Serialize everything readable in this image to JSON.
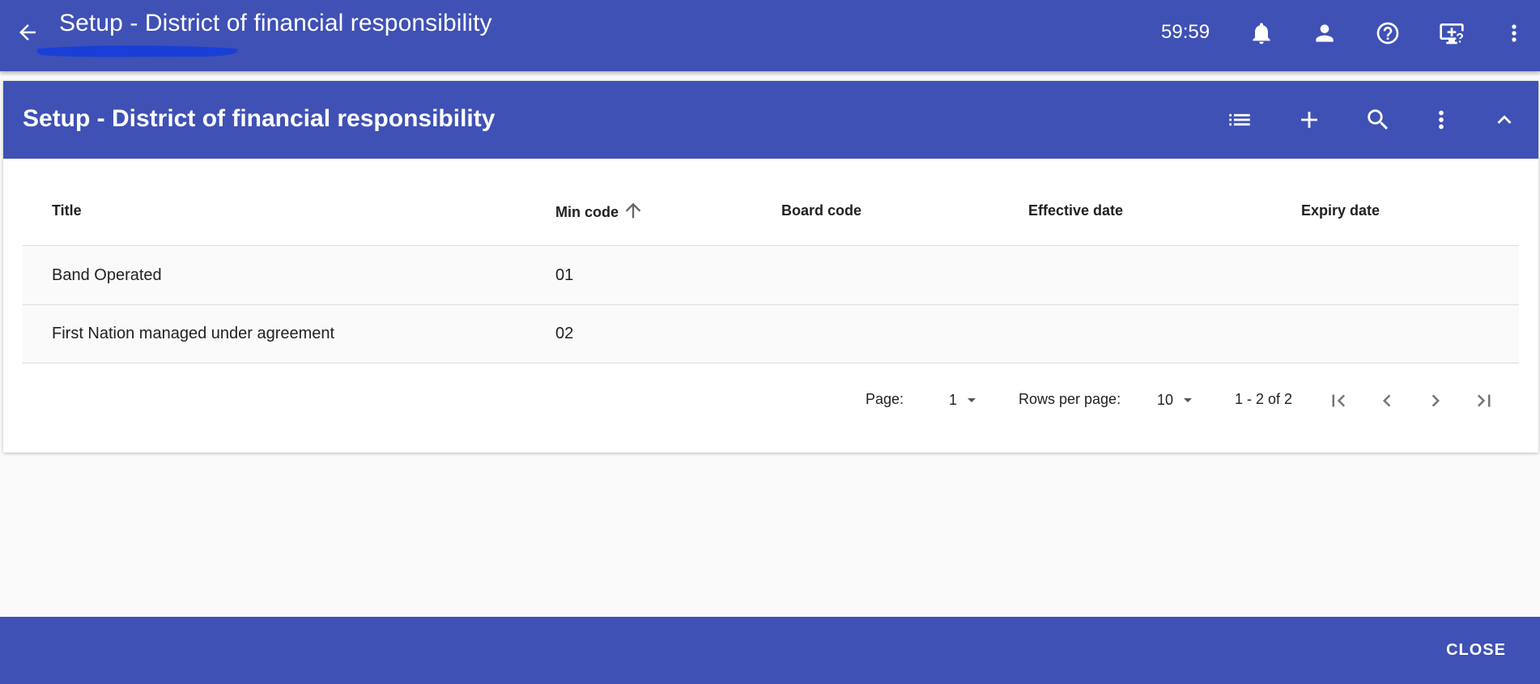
{
  "app": {
    "title": "Setup - District of financial responsibility",
    "timer": "59:59",
    "icons": [
      "back-arrow-icon",
      "bell-icon",
      "person-icon",
      "help-icon",
      "remote-support-icon",
      "more-vert-icon"
    ]
  },
  "card": {
    "title": "Setup - District of financial responsibility",
    "icons": [
      "list-icon",
      "add-icon",
      "search-icon",
      "more-vert-icon",
      "chevron-up-icon"
    ]
  },
  "table": {
    "columns": [
      {
        "label": "Title"
      },
      {
        "label": "Min code",
        "sorted": "ascending"
      },
      {
        "label": "Board code"
      },
      {
        "label": "Effective date"
      },
      {
        "label": "Expiry date"
      }
    ],
    "rows": [
      {
        "title": "Band Operated",
        "min_code": "01",
        "board_code": "",
        "effective_date": "",
        "expiry_date": ""
      },
      {
        "title": "First Nation managed under agreement",
        "min_code": "02",
        "board_code": "",
        "effective_date": "",
        "expiry_date": ""
      }
    ]
  },
  "pagination": {
    "page_label": "Page:",
    "page_value": "1",
    "rows_label": "Rows per page:",
    "rows_value": "10",
    "range": "1 - 2 of 2"
  },
  "footer": {
    "close_label": "CLOSE"
  },
  "colors": {
    "primary": "#3f51b5",
    "background": "#fafafa",
    "redaction": "#1a3fd6"
  }
}
